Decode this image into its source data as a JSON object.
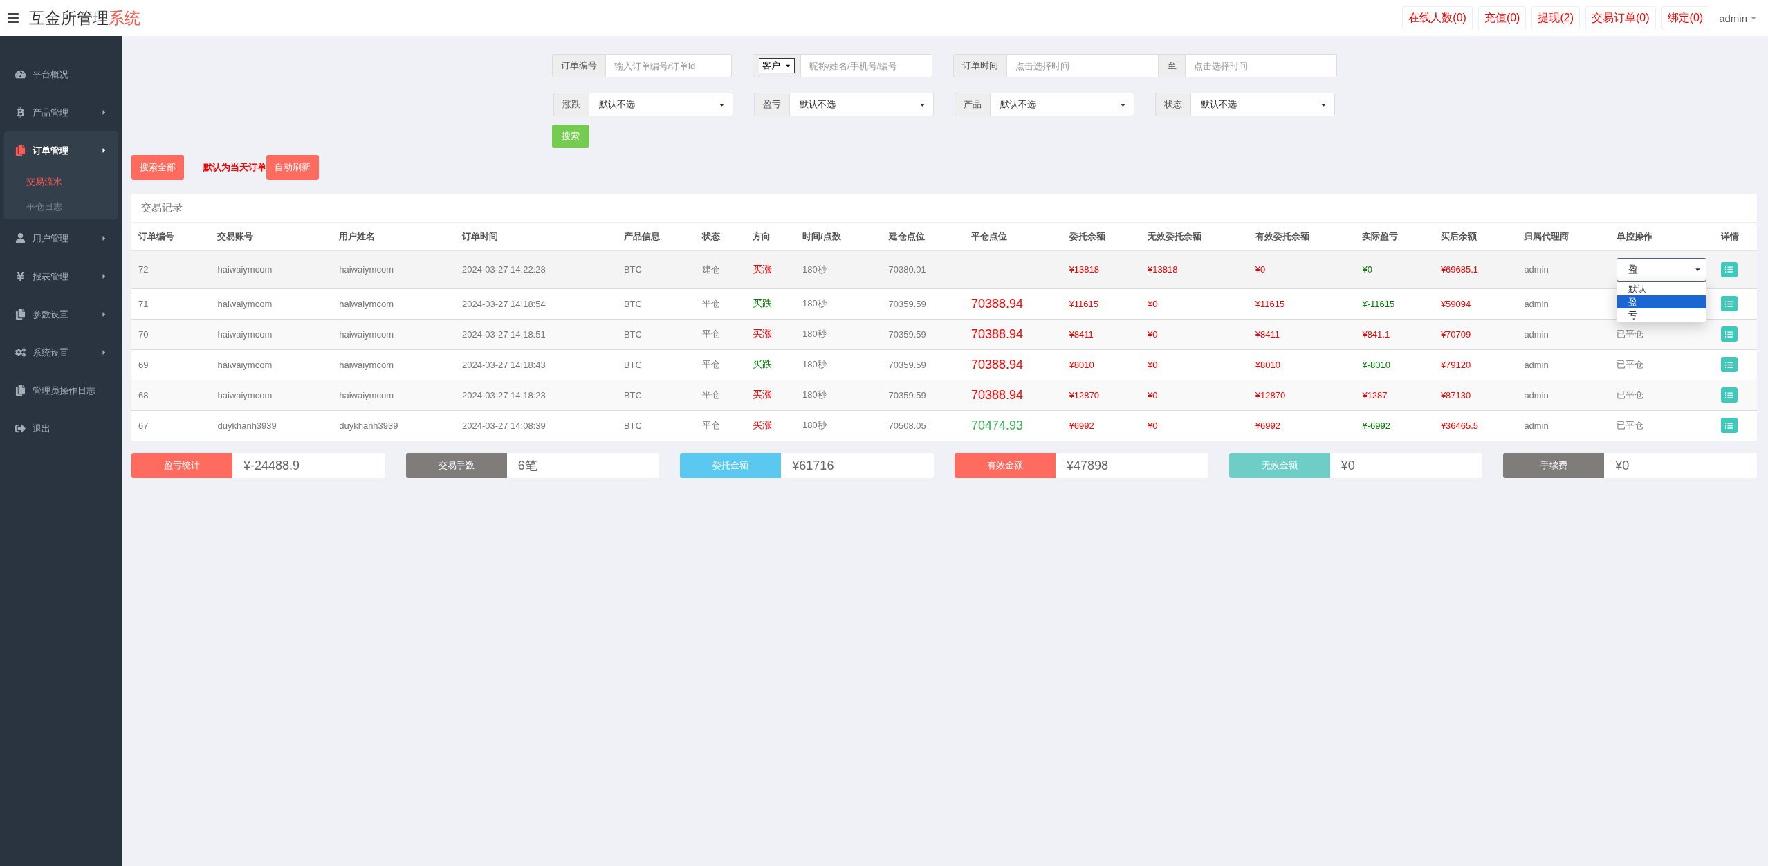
{
  "header": {
    "title": "互金所管理",
    "title_accent": "系统",
    "links": [
      "在线人数(0)",
      "充值(0)",
      "提现(2)",
      "交易订单(0)",
      "绑定(0)"
    ],
    "user": "admin"
  },
  "sidebar": {
    "items": [
      {
        "label": "平台概况",
        "has_children": false,
        "expanded": false
      },
      {
        "label": "产品管理",
        "has_children": true,
        "expanded": false
      },
      {
        "label": "订单管理",
        "has_children": true,
        "expanded": true,
        "children": [
          {
            "label": "交易流水",
            "selected": true
          },
          {
            "label": "平仓日志",
            "selected": false
          }
        ]
      },
      {
        "label": "用户管理",
        "has_children": true,
        "expanded": false
      },
      {
        "label": "报表管理",
        "has_children": true,
        "expanded": false
      },
      {
        "label": "参数设置",
        "has_children": true,
        "expanded": false
      },
      {
        "label": "系统设置",
        "has_children": true,
        "expanded": false
      },
      {
        "label": "管理员操作日志",
        "has_children": false,
        "expanded": false
      },
      {
        "label": "退出",
        "has_children": false,
        "expanded": false
      }
    ]
  },
  "filters": {
    "row1": [
      {
        "kind": "input",
        "label": "订单编号",
        "placeholder": "输入订单编号/订单id"
      },
      {
        "kind": "select-input",
        "select": "客户",
        "placeholder": "昵称/姓名/手机号/编号"
      },
      {
        "kind": "range",
        "label": "订单时间",
        "placeholder": "点击选择时间",
        "separator": "至",
        "placeholder2": "点击选择时间"
      }
    ],
    "row2": [
      {
        "label": "涨跌",
        "value": "默认不选"
      },
      {
        "label": "盈亏",
        "value": "默认不选"
      },
      {
        "label": "产品",
        "value": "默认不选"
      },
      {
        "label": "状态",
        "value": "默认不选"
      }
    ],
    "search_button": "搜索"
  },
  "actions": {
    "search_all": "搜索全部",
    "note": "默认为当天订单",
    "auto_refresh": "自动刷新"
  },
  "table": {
    "title": "交易记录",
    "columns": [
      "订单编号",
      "交易账号",
      "用户姓名",
      "订单时间",
      "产品信息",
      "状态",
      "方向",
      "时间/点数",
      "建仓点位",
      "平仓点位",
      "委托余额",
      "无效委托余额",
      "有效委托余额",
      "实际盈亏",
      "买后余额",
      "归属代理商",
      "单控操作",
      "详情"
    ],
    "rows": [
      {
        "id": "72",
        "account": "haiwaiymcom",
        "name": "haiwaiymcom",
        "time": "2024-03-27 14:22:28",
        "product": "BTC",
        "status": "建仓",
        "direction": {
          "text": "买涨",
          "color": "#ff0000"
        },
        "duration": "180秒",
        "open_price": "70380.01",
        "close_price": null,
        "entrust": "¥13818",
        "invalid": "¥13818",
        "valid": "¥0",
        "pnl": {
          "text": "¥0",
          "color": "#008000"
        },
        "balance": "¥69685.1",
        "agent": "admin",
        "action": {
          "kind": "select",
          "value": "盈",
          "expanded": true,
          "options": [
            {
              "label": "默认",
              "selected": false
            },
            {
              "label": "盈",
              "selected": true
            },
            {
              "label": "亏",
              "selected": false
            }
          ]
        }
      },
      {
        "id": "71",
        "account": "haiwaiymcom",
        "name": "haiwaiymcom",
        "time": "2024-03-27 14:18:54",
        "product": "BTC",
        "status": "平仓",
        "direction": {
          "text": "买跌",
          "color": "#008000"
        },
        "duration": "180秒",
        "open_price": "70359.59",
        "close_price": {
          "text": "70388.94",
          "color": "#ff0000"
        },
        "entrust": "¥11615",
        "invalid": "¥0",
        "valid": "¥11615",
        "pnl": {
          "text": "¥-11615",
          "color": "#008000"
        },
        "balance": "¥59094",
        "agent": "admin",
        "action": null
      },
      {
        "id": "70",
        "account": "haiwaiymcom",
        "name": "haiwaiymcom",
        "time": "2024-03-27 14:18:51",
        "product": "BTC",
        "status": "平仓",
        "direction": {
          "text": "买涨",
          "color": "#ff0000"
        },
        "duration": "180秒",
        "open_price": "70359.59",
        "close_price": {
          "text": "70388.94",
          "color": "#ff0000"
        },
        "entrust": "¥8411",
        "invalid": "¥0",
        "valid": "¥8411",
        "pnl": {
          "text": "¥841.1",
          "color": "#ff0000"
        },
        "balance": "¥70709",
        "agent": "admin",
        "action": {
          "kind": "text",
          "text": "已平仓"
        }
      },
      {
        "id": "69",
        "account": "haiwaiymcom",
        "name": "haiwaiymcom",
        "time": "2024-03-27 14:18:43",
        "product": "BTC",
        "status": "平仓",
        "direction": {
          "text": "买跌",
          "color": "#008000"
        },
        "duration": "180秒",
        "open_price": "70359.59",
        "close_price": {
          "text": "70388.94",
          "color": "#ff0000"
        },
        "entrust": "¥8010",
        "invalid": "¥0",
        "valid": "¥8010",
        "pnl": {
          "text": "¥-8010",
          "color": "#008000"
        },
        "balance": "¥79120",
        "agent": "admin",
        "action": {
          "kind": "text",
          "text": "已平仓"
        }
      },
      {
        "id": "68",
        "account": "haiwaiymcom",
        "name": "haiwaiymcom",
        "time": "2024-03-27 14:18:23",
        "product": "BTC",
        "status": "平仓",
        "direction": {
          "text": "买涨",
          "color": "#ff0000"
        },
        "duration": "180秒",
        "open_price": "70359.59",
        "close_price": {
          "text": "70388.94",
          "color": "#ff0000"
        },
        "entrust": "¥12870",
        "invalid": "¥0",
        "valid": "¥12870",
        "pnl": {
          "text": "¥1287",
          "color": "#ff0000"
        },
        "balance": "¥87130",
        "agent": "admin",
        "action": {
          "kind": "text",
          "text": "已平仓"
        }
      },
      {
        "id": "67",
        "account": "duykhanh3939",
        "name": "duykhanh3939",
        "time": "2024-03-27 14:08:39",
        "product": "BTC",
        "status": "平仓",
        "direction": {
          "text": "买涨",
          "color": "#ff0000"
        },
        "duration": "180秒",
        "open_price": "70508.05",
        "close_price": {
          "text": "70474.93",
          "color": "#3cb05a"
        },
        "entrust": "¥6992",
        "invalid": "¥0",
        "valid": "¥6992",
        "pnl": {
          "text": "¥-6992",
          "color": "#008000"
        },
        "balance": "¥36465.5",
        "agent": "admin",
        "action": {
          "kind": "text",
          "text": "已平仓"
        }
      }
    ]
  },
  "summary": [
    {
      "label": "盈亏统计",
      "value": "¥-24488.9",
      "color": "#ff6b5e"
    },
    {
      "label": "交易手数",
      "value": "6笔",
      "color": "#7f7c7a"
    },
    {
      "label": "委托金额",
      "value": "¥61716",
      "color": "#5bc8f2"
    },
    {
      "label": "有效金额",
      "value": "¥47898",
      "color": "#ff6b5e"
    },
    {
      "label": "无效金额",
      "value": "¥0",
      "color": "#6fcdc8"
    },
    {
      "label": "手续费",
      "value": "¥0",
      "color": "#7f7c7a"
    }
  ]
}
